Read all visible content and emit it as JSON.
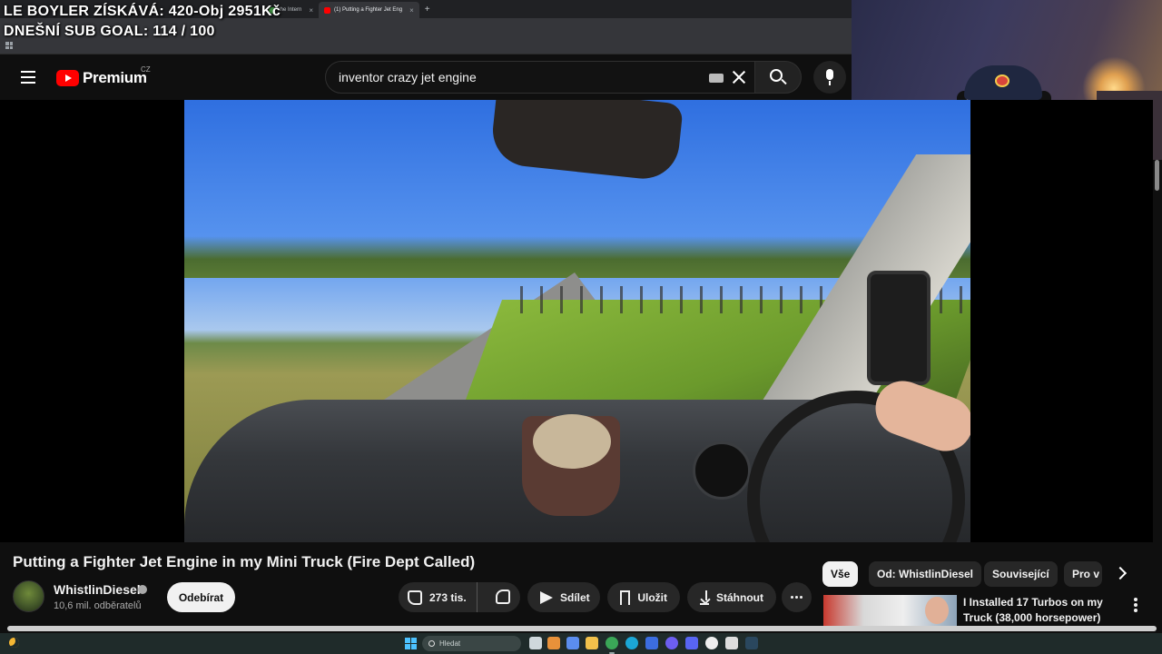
{
  "overlay": {
    "line1": "LE BOYLER ZÍSKÁVÁ: 420-Obj 2951Kč",
    "line2": "DNEŠNÍ SUB GOAL: 114 / 100"
  },
  "browser": {
    "tabs": [
      {
        "label": "the Intern",
        "active": false
      },
      {
        "label": "(1) Putting a Fighter Jet Eng",
        "active": true
      }
    ]
  },
  "masthead": {
    "brand": "Premium",
    "region": "CZ",
    "search": {
      "value": "inventor crazy jet engine"
    }
  },
  "video": {
    "title": "Putting a Fighter Jet Engine in my Mini Truck (Fire Dept Called)",
    "channel": {
      "name": "WhistlinDiesel",
      "subscribers": "10,6 mil. odběratelů"
    },
    "subscribe_label": "Odebírat",
    "actions": {
      "likes": "273 tis.",
      "share": "Sdílet",
      "save": "Uložit",
      "download": "Stáhnout"
    }
  },
  "sidebar": {
    "chips": [
      "Vše",
      "Od: WhistlinDiesel",
      "Související",
      "Pro v"
    ],
    "recommendation": {
      "title": "I Installed 17 Turbos on my Truck (38,000 horsepower)"
    }
  },
  "taskbar": {
    "search_placeholder": "Hledat"
  },
  "colors": {
    "background": "#0f0f0f",
    "youtube_red": "#ff0000",
    "pill": "#272727",
    "active_chip": "#f1f1f1"
  }
}
